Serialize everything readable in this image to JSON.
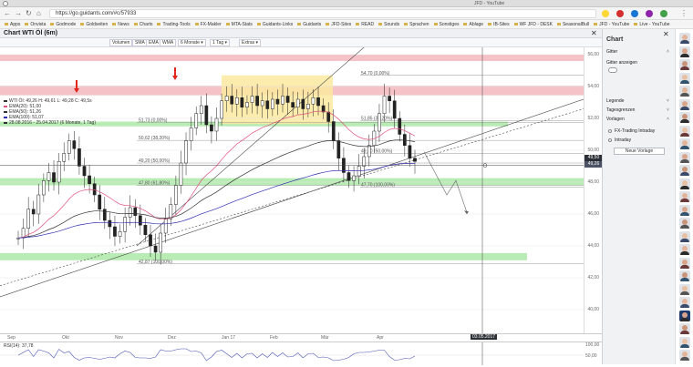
{
  "browser": {
    "url": "https://go.guidants.com/#c/57933",
    "tab_title": "JFD - YouTube",
    "bookmarks": [
      "Apps",
      "Onvista",
      "Godmode",
      "Goldseiten",
      "News",
      "Charts",
      "Trading-Tools",
      "FX-Makler",
      "MTA-Stats",
      "Guidants-Links",
      "Guidants",
      "JFD-Sites",
      "READ",
      "Sounds",
      "Sprachen",
      "Sonstiges",
      "Ablage",
      "IB-Sites",
      "WF JFD - DESK",
      "SeasonalBull",
      "JFD - YouTube",
      "Live - YouTube"
    ]
  },
  "chart_panel": {
    "title": "Chart WTI Öl (6m)",
    "toolbar": [
      "Volumen",
      "SMA",
      "EMA",
      "WMA",
      "6 Monate",
      "1 Tag",
      "Extras"
    ],
    "legend": [
      {
        "text": "WTI Öl: 49,26 H: 49,61 L: 49,28 C: 49,5s",
        "color": "#333333"
      },
      {
        "text": "EMA(20): 51,00",
        "color": "#e0507a"
      },
      {
        "text": "EMA(50): 51,26",
        "color": "#333333"
      },
      {
        "text": "EMA(100): 51,07",
        "color": "#2d2db0"
      },
      {
        "text": "28.08.2016 - 25.04.2017  (6 Monate, 1 Tag)",
        "color": "#333333"
      }
    ],
    "y_ticks": [
      "56,00",
      "54,00",
      "52,00",
      "50,00",
      "48,00",
      "46,00",
      "44,00",
      "42,00",
      "40,00"
    ],
    "current_price": "49,50",
    "current_price_2": "49,26",
    "current_price_color": "#2b2f36",
    "x_ticks": [
      "Sep",
      "Okt",
      "Nov",
      "Dez",
      "Jan 17",
      "Feb",
      "Mär",
      "Apr"
    ],
    "crosshair_date": "03.05.2017",
    "fib_left": [
      "51,73 (0,00%)",
      "50,62 (38,20%)",
      "49,20 (50,00%)",
      "47,80 (61,80%)",
      "42,87 (100,00%)"
    ],
    "fib_right": [
      "54,70 (0,00%)",
      "51,85 (38,20%)",
      "49,80 (50,00%)",
      "47,70 (100,00%)"
    ],
    "rsi_label": "RSI(14): 37,78",
    "rsi_ticks": [
      "100,00",
      "50,00"
    ],
    "colors": {
      "resistance": "#f4c2c7",
      "support": "#b9ecb4",
      "range_box": "#fbe9a0",
      "ema20": "#e0507a",
      "ema50": "#333333",
      "ema100": "#2d2db0",
      "arrow": "#e0251b"
    }
  },
  "sidebar": {
    "title": "Chart",
    "sections": [
      "Gitter",
      "Legende",
      "Tagesgrenzen",
      "Vorlagen"
    ],
    "grid_label": "Gitter anzeigen",
    "templates": [
      "FX-Trading Intraday",
      "Intraday"
    ],
    "new_template_button": "Neue Vorlage"
  }
}
